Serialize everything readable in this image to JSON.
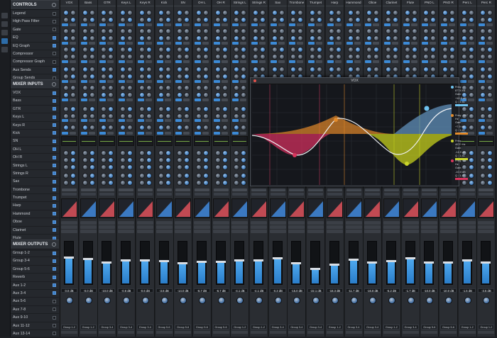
{
  "controls": {
    "header": "CONTROLS",
    "items": [
      {
        "label": "Legend",
        "checked": false
      },
      {
        "label": "High Pass Filter",
        "checked": false
      },
      {
        "label": "Gate",
        "checked": false
      },
      {
        "label": "EQ",
        "checked": true
      },
      {
        "label": "EQ Graph",
        "checked": true
      },
      {
        "label": "Compressor",
        "checked": false
      },
      {
        "label": "Compressor Graph",
        "checked": false
      },
      {
        "label": "Aux Sends",
        "checked": true
      },
      {
        "label": "Group Sends",
        "checked": false
      }
    ]
  },
  "inputs": {
    "header": "MIXER INPUTS",
    "items": [
      "VOX",
      "Bass",
      "GTR",
      "Keys L",
      "Keys R",
      "Kick",
      "SN",
      "OH L",
      "OH R",
      "Strings L",
      "Strings R",
      "Sax",
      "Trombone",
      "Trumpet",
      "Harp",
      "Hammond",
      "Oboe",
      "Clarinet",
      "Flute",
      "PNO L"
    ]
  },
  "outputs": {
    "header": "MIXER OUTPUTS",
    "items": [
      "Group 1-2",
      "Group 3-4",
      "Group 5-6",
      "Reverb",
      "Aux 1-2",
      "Aux 3-4",
      "Aux 5-6",
      "Aux 7-8",
      "Aux 9-10",
      "Aux 11-12",
      "Aux 13-14"
    ]
  },
  "strips": [
    {
      "name": "VOX",
      "level": 0.62,
      "value": "0.0 dB",
      "route": "Group 1-2"
    },
    {
      "name": "Bass",
      "level": 0.58,
      "value": "-0.0 dB",
      "route": "Group 1-2"
    },
    {
      "name": "GTR",
      "level": 0.5,
      "value": "-10.0 dB",
      "route": "Group 3-4"
    },
    {
      "name": "Keys L",
      "level": 0.56,
      "value": "-0.6 dB",
      "route": "Group 3-4"
    },
    {
      "name": "Keys R",
      "level": 0.56,
      "value": "-0.6 dB",
      "route": "Group 3-4"
    },
    {
      "name": "Kick",
      "level": 0.53,
      "value": "-3.6 dB",
      "route": "Group 5-6"
    },
    {
      "name": "SN",
      "level": 0.48,
      "value": "-14.0 dB",
      "route": "Group 5-6"
    },
    {
      "name": "OH L",
      "level": 0.52,
      "value": "-6.7 dB",
      "route": "Group 5-6"
    },
    {
      "name": "OH R",
      "level": 0.52,
      "value": "-6.7 dB",
      "route": "Group 5-6"
    },
    {
      "name": "Strings L",
      "level": 0.55,
      "value": "-4.1 dB",
      "route": "Group 1-2"
    },
    {
      "name": "Strings R",
      "level": 0.55,
      "value": "-4.1 dB",
      "route": "Group 1-2"
    },
    {
      "name": "Sax",
      "level": 0.6,
      "value": "-0.3 dB",
      "route": "Group 3-4"
    },
    {
      "name": "Trombone",
      "level": 0.48,
      "value": "-15.0 dB",
      "route": "Group 3-4"
    },
    {
      "name": "Trumpet",
      "level": 0.35,
      "value": "-22.1 dB",
      "route": "Group 3-4"
    },
    {
      "name": "Harp",
      "level": 0.45,
      "value": "-18.3 dB",
      "route": "Group 1-2"
    },
    {
      "name": "Hammond",
      "level": 0.57,
      "value": "-11.7 dB",
      "route": "Group 3-4"
    },
    {
      "name": "Oboe",
      "level": 0.5,
      "value": "-16.8 dB",
      "route": "Group 3-4"
    },
    {
      "name": "Clarinet",
      "level": 0.53,
      "value": "-5.2 dB",
      "route": "Group 1-2"
    },
    {
      "name": "Flute",
      "level": 0.6,
      "value": "-1.7 dB",
      "route": "Group 3-4"
    },
    {
      "name": "PNO L",
      "level": 0.5,
      "value": "-10.0 dB",
      "route": "Group 5-6"
    },
    {
      "name": "PNO R",
      "level": 0.5,
      "value": "-10.0 dB",
      "route": "Group 5-6"
    },
    {
      "name": "Perc L",
      "level": 0.55,
      "value": "-1.5 dB",
      "route": "Group 1-2"
    },
    {
      "name": "Perc R",
      "level": 0.5,
      "value": "-3.5 dB",
      "route": "Group 1-2"
    }
  ],
  "eq_window": {
    "title": "VOX",
    "bands": [
      {
        "freq": "Freq : 8774 Hz",
        "gain": "Gain : +10.5 dB",
        "q": "Q : 1.41",
        "color": "#6ec3f0"
      },
      {
        "freq": "Freq : 247 Hz",
        "gain": "Gain : +7.9 dB",
        "q": "Q : 1.41",
        "color": "#e38b2b"
      },
      {
        "freq": "Freq : 4070 Hz",
        "gain": "Gain : -14.9 dB",
        "q": "Q : 1.41",
        "color": "#c9d42a"
      },
      {
        "freq": "Freq : 65 Hz",
        "gain": "Gain : -10.0 dB",
        "q": "Q : 1.41",
        "color": "#d8365d"
      }
    ]
  },
  "colors": {
    "accent": "#3c8ad6",
    "panel": "#25282d",
    "strip": "#2a2d32"
  }
}
